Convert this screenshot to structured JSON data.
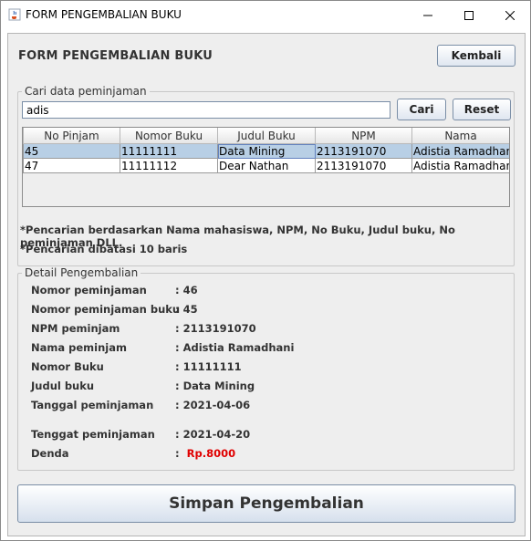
{
  "window": {
    "title": "FORM PENGEMBALIAN BUKU"
  },
  "header": {
    "title": "FORM PENGEMBALIAN BUKU",
    "back_label": "Kembali"
  },
  "search": {
    "group_title": "Cari data peminjaman",
    "value": "adis",
    "search_label": "Cari",
    "reset_label": "Reset"
  },
  "table": {
    "columns": [
      "No Pinjam",
      "Nomor Buku",
      "Judul Buku",
      "NPM",
      "Nama"
    ],
    "rows": [
      [
        "45",
        "11111111",
        "Data Mining",
        "2113191070",
        "Adistia Ramadhani"
      ],
      [
        "47",
        "11111112",
        "Dear Nathan",
        "2113191070",
        "Adistia Ramadhani"
      ]
    ],
    "selected_row": 0
  },
  "notes": {
    "line1": "*Pencarian berdasarkan Nama mahasiswa, NPM, No Buku, Judul buku, No peminjaman DLL.",
    "line2": "*Pencarian dibatasi 10 baris"
  },
  "detail": {
    "group_title": "Detail Pengembalian",
    "fields": [
      {
        "label": "Nomor peminjaman",
        "value": ": 46"
      },
      {
        "label": "Nomor peminjaman buku",
        "value": ": 45"
      },
      {
        "label": "NPM peminjam",
        "value": ": 2113191070"
      },
      {
        "label": "Nama peminjam",
        "value": ": Adistia Ramadhani"
      },
      {
        "label": "Nomor Buku",
        "value": ": 11111111"
      },
      {
        "label": "Judul buku",
        "value": ": Data Mining"
      },
      {
        "label": "Tanggal peminjaman",
        "value": ": 2021-04-06"
      },
      {
        "label": "Tenggat peminjaman",
        "value": ": 2021-04-20"
      },
      {
        "label": "Denda",
        "value_prefix": ":",
        "value": "Rp.8000"
      }
    ],
    "fine_color": "#e00000"
  },
  "footer": {
    "save_label": "Simpan Pengembalian"
  },
  "icons": {
    "app": "java-cup-icon",
    "minimize": "minimize-icon",
    "maximize": "maximize-icon",
    "close": "close-icon"
  }
}
